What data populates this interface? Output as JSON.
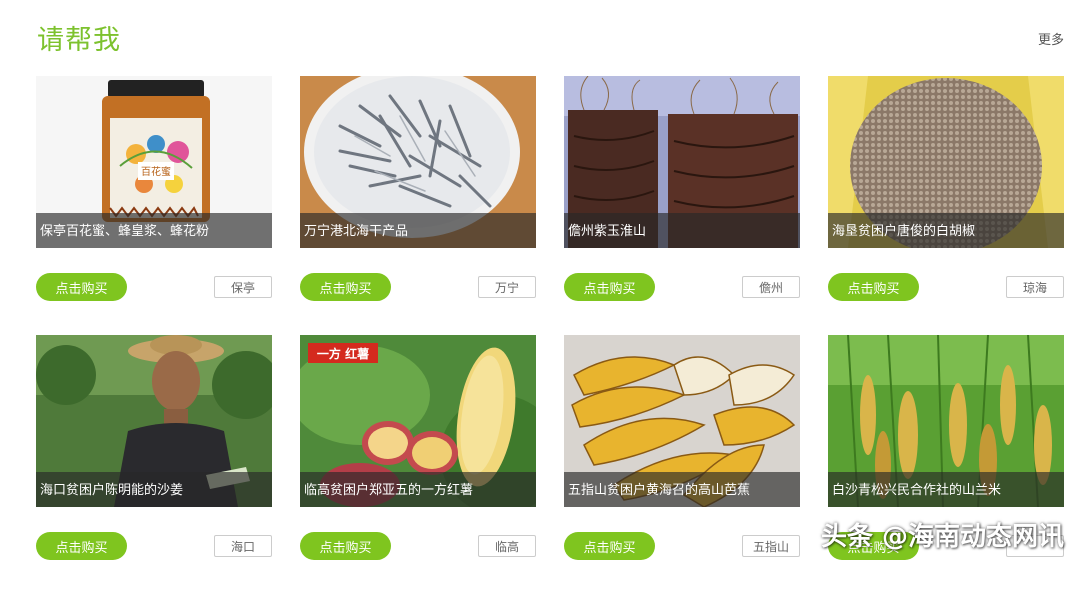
{
  "section": {
    "title": "请帮我",
    "more_label": "更多"
  },
  "products": [
    {
      "caption": "保亭百花蜜、蜂皇浆、蜂花粉",
      "buy_label": "点击购买",
      "region": "保亭",
      "image": "honey-jar"
    },
    {
      "caption": "万宁港北海干产品",
      "buy_label": "点击购买",
      "region": "万宁",
      "image": "dried-fish"
    },
    {
      "caption": "儋州紫玉淮山",
      "buy_label": "点击购买",
      "region": "儋州",
      "image": "yam"
    },
    {
      "caption": "海垦贫困户唐俊的白胡椒",
      "buy_label": "点击购买",
      "region": "琼海",
      "image": "white-pepper"
    },
    {
      "caption": "海口贫困户陈明能的沙姜",
      "buy_label": "点击购买",
      "region": "海口",
      "image": "farmer"
    },
    {
      "caption": "临高贫困户郑亚五的一方红薯",
      "buy_label": "点击购买",
      "region": "临高",
      "image": "sweet-potato"
    },
    {
      "caption": "五指山贫困户黄海召的高山芭蕉",
      "buy_label": "点击购买",
      "region": "五指山",
      "image": "bananas"
    },
    {
      "caption": "白沙青松兴民合作社的山兰米",
      "buy_label": "点击购买",
      "region": "",
      "image": "rice-field"
    }
  ],
  "image_text": {
    "honey_label": "百花蜜",
    "sweet_potato_brand": "一方 红薯"
  },
  "watermark": "头条 @海南动态网讯",
  "colors": {
    "accent": "#7dc22e",
    "button": "#7fc51f"
  }
}
